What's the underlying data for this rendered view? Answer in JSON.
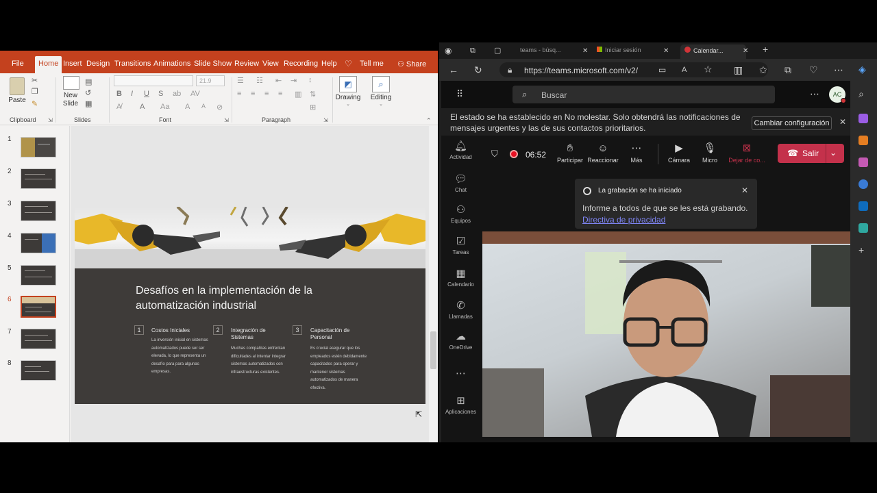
{
  "ppt": {
    "tabs": [
      "File",
      "Home",
      "Insert",
      "Design",
      "Transitions",
      "Animations",
      "Slide Show",
      "Review",
      "View",
      "Recording",
      "Help",
      "Tell me"
    ],
    "share_label": "Share",
    "ribbon": {
      "paste_label": "Paste",
      "clipboard_label": "Clipboard",
      "new_slide_label": "New Slide",
      "slides_label": "Slides",
      "font_label": "Font",
      "paragraph_label": "Paragraph",
      "font_size": "21.9",
      "drawing_label": "Drawing",
      "editing_label": "Editing"
    },
    "thumbnails": [
      "1",
      "2",
      "3",
      "4",
      "5",
      "6",
      "7",
      "8"
    ],
    "selected_slide": 6,
    "slide": {
      "title": "Desafíos en la implementación de la automatización industrial",
      "columns": [
        {
          "num": "1",
          "heading": "Costos Iniciales",
          "body": "La inversión inicial en sistemas automatizados puede ser ser elevada, lo que representa un desafío para para algunas empresas."
        },
        {
          "num": "2",
          "heading": "Integración de Sistemas",
          "body": "Muchas compañías enfrentan dificultades al intentar integrar sistemas automatizados con infraestructuras existentes."
        },
        {
          "num": "3",
          "heading": "Capacitación de Personal",
          "body": "Es crucial asegurar que los empleados estén debidamente capacitados para operar y mantener sistemas automatizados de manera efectiva."
        }
      ]
    }
  },
  "edge": {
    "tabs": [
      "teams - búsq...",
      "Iniciar sesión",
      "Calendar..."
    ],
    "url": "https://teams.microsoft.com/v2/"
  },
  "teams": {
    "search_placeholder": "Buscar",
    "avatar_initials": "AC",
    "dnd_message": "El estado se ha establecido en No molestar. Solo obtendrá las notificaciones de mensajes urgentes y las de sus contactos prioritarios.",
    "dnd_button": "Cambiar configuración",
    "rail": [
      "Actividad",
      "Chat",
      "Equipos",
      "Tareas",
      "Calendario",
      "Llamadas",
      "OneDrive",
      "Aplicaciones"
    ],
    "timer": "06:52",
    "meeting_actions": [
      "Participar",
      "Reaccionar",
      "Más",
      "Cámara",
      "Micro",
      "Dejar de co..."
    ],
    "leave_label": "Salir",
    "recording": {
      "title": "La grabación se ha iniciado",
      "message": "Informe a todos de que se les está grabando.",
      "link": "Directiva de privacidad"
    }
  },
  "colors": {
    "ppt_accent": "#c4411e",
    "teams_leave": "#c4314b",
    "teams_link": "#7f85f5"
  }
}
